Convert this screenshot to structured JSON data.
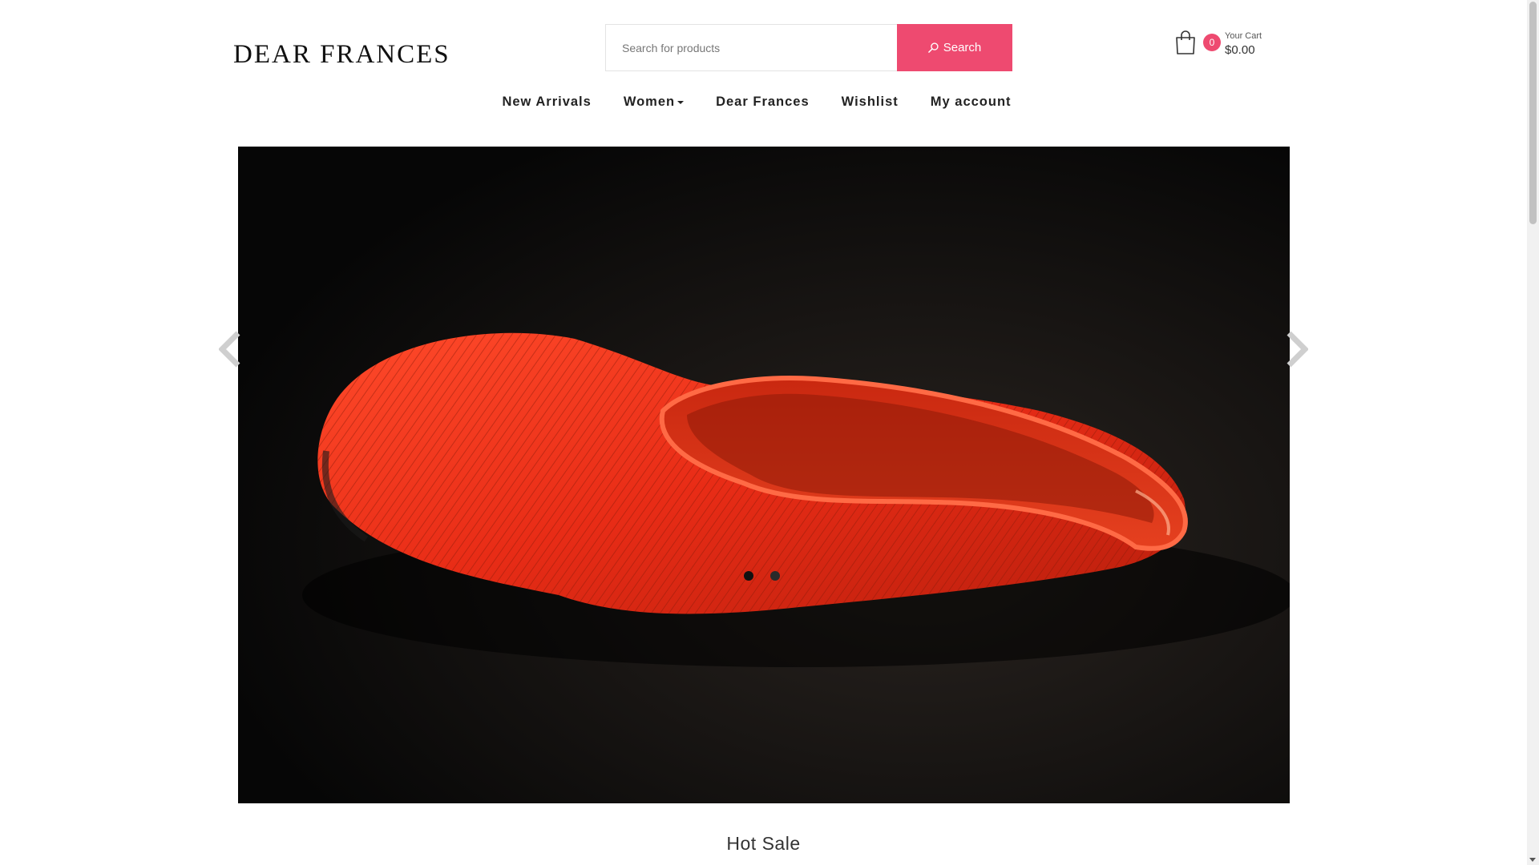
{
  "brand": {
    "name": "DEAR FRANCES"
  },
  "search": {
    "placeholder": "Search for products",
    "button_label": "Search"
  },
  "cart": {
    "count": "0",
    "label": "Your Cart",
    "total": "$0.00"
  },
  "nav": [
    {
      "label": "New Arrivals"
    },
    {
      "label": "Women",
      "has_dropdown": true
    },
    {
      "label": "Dear Frances"
    },
    {
      "label": "Wishlist"
    },
    {
      "label": "My account"
    }
  ],
  "slider": {
    "slides_total": 2,
    "active_slide": 1
  },
  "sections": {
    "hot_sale_title": "Hot Sale"
  },
  "colors": {
    "accent": "#ee4a70",
    "shoe": "#e8301e",
    "hero_bg": "#070707"
  },
  "icons": {
    "search": "search-icon",
    "cart": "shopping-bag-icon",
    "prev": "chevron-left-icon",
    "next": "chevron-right-icon"
  }
}
